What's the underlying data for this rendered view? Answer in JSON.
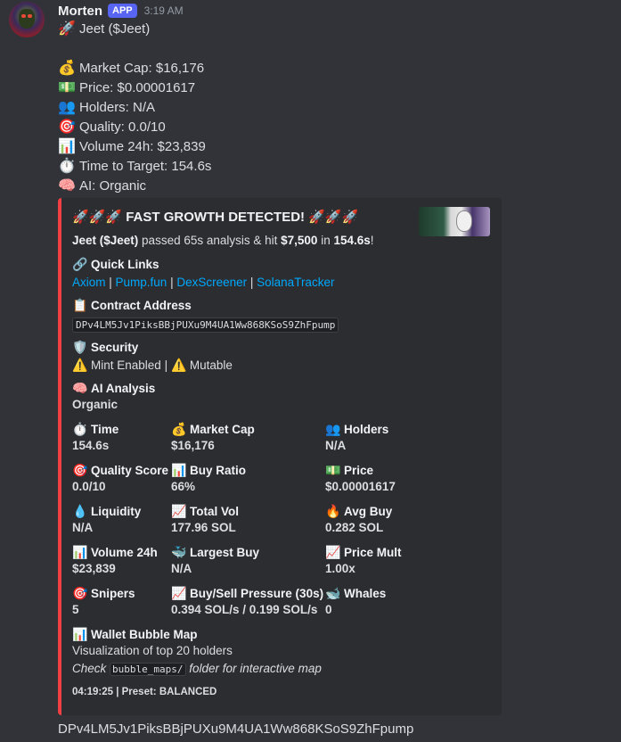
{
  "message": {
    "username": "Morten",
    "badge": "APP",
    "timestamp": "3:19 AM",
    "lines": [
      {
        "icon": "🚀",
        "icon_name": "rocket-icon",
        "text": "Jeet ($Jeet)"
      },
      {
        "icon": "",
        "icon_name": "",
        "text": ""
      },
      {
        "icon": "💰",
        "icon_name": "money-bag-icon",
        "text": "Market Cap: $16,176"
      },
      {
        "icon": "💵",
        "icon_name": "dollar-bill-icon",
        "text": "Price: $0.00001617"
      },
      {
        "icon": "👥",
        "icon_name": "people-icon",
        "text": "Holders: N/A"
      },
      {
        "icon": "🎯",
        "icon_name": "target-icon",
        "text": "Quality: 0.0/10"
      },
      {
        "icon": "📊",
        "icon_name": "bar-chart-icon",
        "text": "Volume 24h: $23,839"
      },
      {
        "icon": "⏱️",
        "icon_name": "stopwatch-icon",
        "text": "Time to Target: 154.6s"
      },
      {
        "icon": "🧠",
        "icon_name": "brain-icon",
        "text": "AI: Organic"
      }
    ]
  },
  "embed": {
    "accent_color": "#f23f43",
    "title": "🚀🚀🚀 FAST GROWTH DETECTED! 🚀🚀🚀",
    "description": {
      "name": "Jeet ($Jeet)",
      "t1": " passed 65s analysis & hit ",
      "target": "$7,500",
      "t2": " in ",
      "time": "154.6s",
      "t3": "!"
    },
    "quick_links": {
      "icon": "🔗",
      "label": "Quick Links",
      "links": [
        "Axiom",
        "Pump.fun",
        "DexScreener",
        "SolanaTracker"
      ],
      "separator": " | "
    },
    "contract": {
      "icon": "📋",
      "label": "Contract Address",
      "value": "DPv4LM5Jv1PiksBBjPUXu9M4UA1Ww868KSoS9ZhFpump"
    },
    "security": {
      "icon": "🛡️",
      "label": "Security",
      "warn_icon": "⚠️",
      "item1": "Mint Enabled",
      "sep": " | ",
      "item2": "Mutable"
    },
    "ai_analysis": {
      "icon": "🧠",
      "label": "AI Analysis",
      "value": "Organic"
    },
    "grid": [
      {
        "icon": "⏱️",
        "icon_name": "stopwatch-icon",
        "label": "Time",
        "value": "154.6s"
      },
      {
        "icon": "💰",
        "icon_name": "money-bag-icon",
        "label": "Market Cap",
        "value": "$16,176"
      },
      {
        "icon": "👥",
        "icon_name": "people-icon",
        "label": "Holders",
        "value": "N/A"
      },
      {
        "icon": "🎯",
        "icon_name": "target-icon",
        "label": "Quality Score",
        "value": "0.0/10"
      },
      {
        "icon": "📊",
        "icon_name": "bar-chart-icon",
        "label": "Buy Ratio",
        "value": "66%"
      },
      {
        "icon": "💵",
        "icon_name": "dollar-bill-icon",
        "label": "Price",
        "value": "$0.00001617"
      },
      {
        "icon": "💧",
        "icon_name": "droplet-icon",
        "label": "Liquidity",
        "value": "N/A"
      },
      {
        "icon": "📈",
        "icon_name": "chart-up-icon",
        "label": "Total Vol",
        "value": "177.96 SOL"
      },
      {
        "icon": "🔥",
        "icon_name": "fire-icon",
        "label": "Avg Buy",
        "value": "0.282 SOL"
      },
      {
        "icon": "📊",
        "icon_name": "bar-chart-icon",
        "label": "Volume 24h",
        "value": "$23,839"
      },
      {
        "icon": "🐳",
        "icon_name": "whale-icon",
        "label": "Largest Buy",
        "value": "N/A"
      },
      {
        "icon": "📈",
        "icon_name": "chart-up-icon",
        "label": "Price Mult",
        "value": "1.00x"
      },
      {
        "icon": "🎯",
        "icon_name": "target-icon",
        "label": "Snipers",
        "value": "5"
      },
      {
        "icon": "📈",
        "icon_name": "chart-up-icon",
        "label": "Buy/Sell Pressure (30s)",
        "value": "0.394 SOL/s / 0.199 SOL/s"
      },
      {
        "icon": "🐋",
        "icon_name": "whale-icon",
        "label": "Whales",
        "value": "0"
      }
    ],
    "bubble_map": {
      "icon": "📊",
      "label": "Wallet Bubble Map",
      "line1": "Visualization of top 20 holders",
      "check": "Check ",
      "folder": "bubble_maps/",
      "rest": " folder for interactive map"
    },
    "footer": "04:19:25 | Preset: BALANCED"
  },
  "bottom_text": "DPv4LM5Jv1PiksBBjPUXu9M4UA1Ww868KSoS9ZhFpump"
}
